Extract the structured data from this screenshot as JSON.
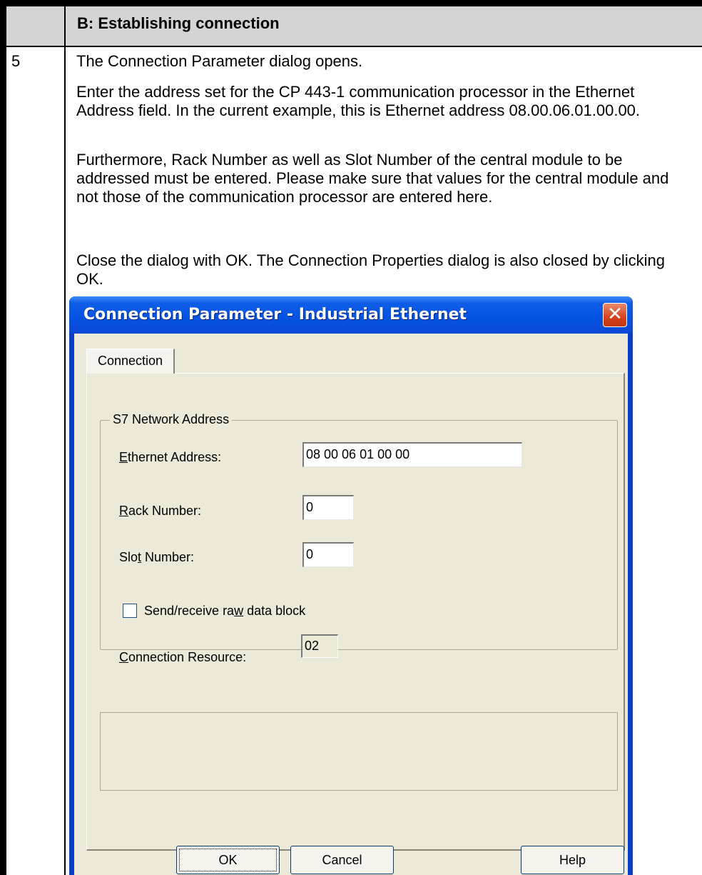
{
  "document": {
    "section_title": "B: Establishing connection",
    "step_number": "5",
    "paragraphs": [
      "The Connection Parameter dialog opens.",
      "Enter the address set for the CP 443-1 communication processor in the Ethernet Address field. In the current example, this is Ethernet address 08.00.06.01.00.00.",
      "Furthermore, Rack Number as well as Slot Number of the central module to be addressed must be entered. Please make sure that values for the central module and not those of the communication processor are entered here.",
      "Close the dialog with OK. The Connection Properties dialog is also closed by clicking OK."
    ]
  },
  "dialog": {
    "title": "Connection Parameter - Industrial Ethernet",
    "close_icon": "close-icon",
    "tab_label": "Connection",
    "group_label": "S7 Network Address",
    "ethernet_address": {
      "label_prefix": "",
      "label_accel": "E",
      "label_rest": "thernet Address:",
      "value": "08 00 06 01 00 00"
    },
    "rack_number": {
      "label_prefix": "",
      "label_accel": "R",
      "label_rest": "ack Number:",
      "value": "0"
    },
    "slot_number": {
      "label_prefix": "Slo",
      "label_accel": "t",
      "label_rest": " Number:",
      "value": "0"
    },
    "raw_data_checkbox": {
      "label_prefix": "Send/receive ra",
      "label_accel": "w",
      "label_rest": " data block",
      "checked": false
    },
    "connection_resource": {
      "label_prefix": "",
      "label_accel": "C",
      "label_rest": "onnection Resource:",
      "value": "02"
    },
    "buttons": {
      "ok": "OK",
      "cancel": "Cancel",
      "help": "Help"
    }
  },
  "colors": {
    "titlebar": "#0553e3",
    "dialog_face": "#ece9d8",
    "header_row": "#d4d4d4"
  }
}
